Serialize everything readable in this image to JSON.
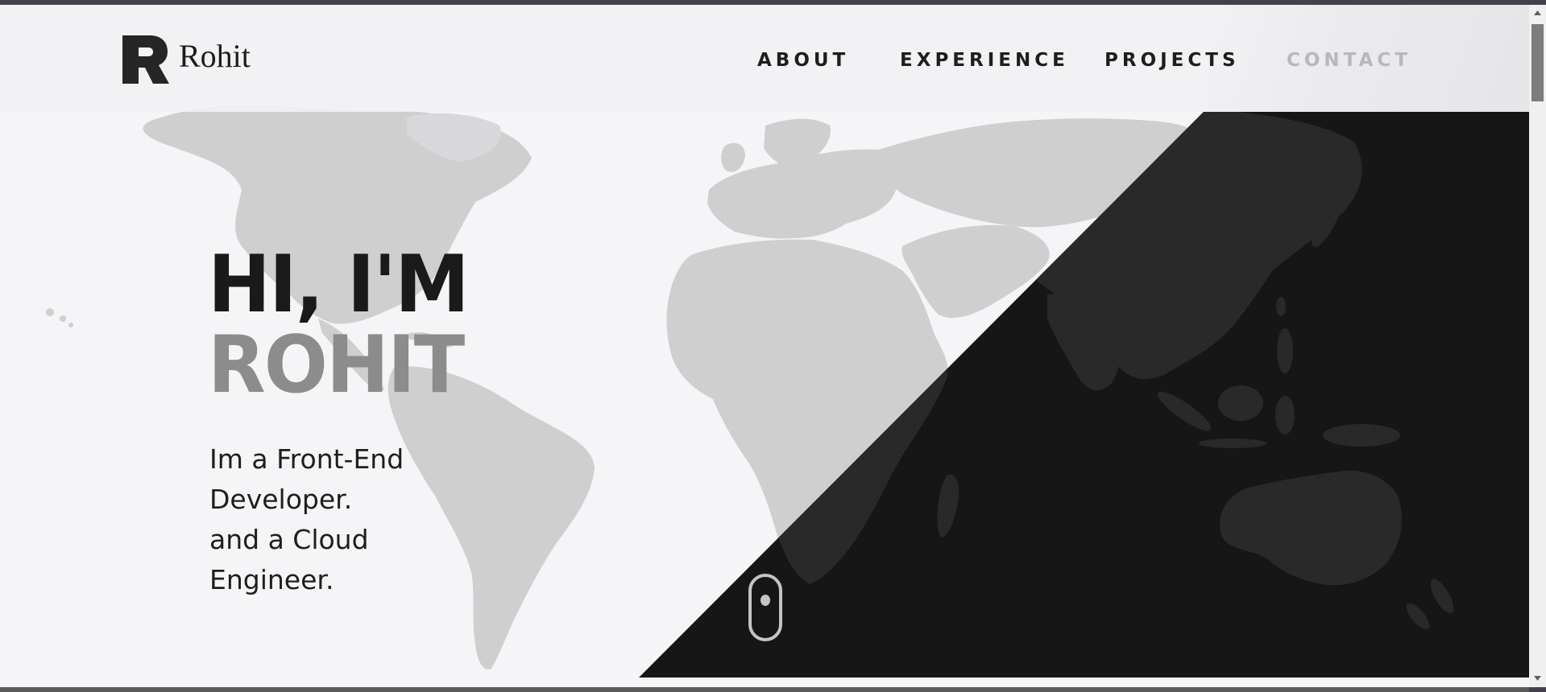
{
  "brand": {
    "name": "Rohit"
  },
  "nav": {
    "items": [
      {
        "label": "ABOUT"
      },
      {
        "label": "EXPERIENCE"
      },
      {
        "label": "PROJECTS"
      },
      {
        "label": "CONTACT"
      }
    ]
  },
  "hero": {
    "greeting": "HI, I'M",
    "name": "ROHIT",
    "tagline": [
      "Im a Front-End",
      "Developer.",
      "and a Cloud",
      "Engineer."
    ]
  },
  "icons": {
    "logo": "logo-r-icon",
    "scroll": "mouse-scroll-icon",
    "scroll_up": "scroll-up-arrow-icon",
    "scroll_down": "scroll-down-arrow-icon"
  },
  "colors": {
    "background": "#f5f5f7",
    "dark_panel": "#161616",
    "map_light": "#c9c9cb",
    "map_dark": "#222222",
    "text_dark": "#1a1a1a",
    "name_gray": "#8c8c8c",
    "nav_inactive": "#b8b8ba"
  }
}
